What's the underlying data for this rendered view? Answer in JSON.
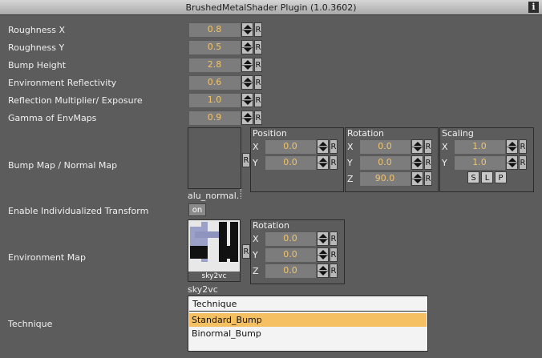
{
  "window": {
    "title": "BrushedMetalShader Plugin (1.0.3602)",
    "info_label": "i"
  },
  "params": [
    {
      "label": "Roughness X",
      "value": "0.8"
    },
    {
      "label": "Roughness Y",
      "value": "0.5"
    },
    {
      "label": "Bump Height",
      "value": "2.8"
    },
    {
      "label": "Environment Reflectivity",
      "value": "0.6"
    },
    {
      "label": "Reflection Multiplier/ Exposure",
      "value": "1.0"
    },
    {
      "label": "Gamma of EnvMaps",
      "value": "0.9"
    }
  ],
  "reset_label": "R",
  "bump": {
    "label": "Bump Map / Normal Map",
    "filename": "alu_normal.",
    "position": {
      "title": "Position",
      "x_label": "X",
      "x": "0.0",
      "y_label": "Y",
      "y": "0.0"
    },
    "rotation": {
      "title": "Rotation",
      "x_label": "X",
      "x": "0.0",
      "y_label": "Y",
      "y": "0.0",
      "z_label": "Z",
      "z": "90.0"
    },
    "scaling": {
      "title": "Scaling",
      "x_label": "X",
      "x": "1.0",
      "y_label": "Y",
      "y": "1.0",
      "buttons": [
        "S",
        "L",
        "P"
      ]
    }
  },
  "transform": {
    "label": "Enable Individualized Transform",
    "toggle": "on"
  },
  "env": {
    "label": "Environment Map",
    "caption": "sky2vc",
    "filename": "sky2vc",
    "rotation": {
      "title": "Rotation",
      "x_label": "X",
      "x": "0.0",
      "y_label": "Y",
      "y": "0.0",
      "z_label": "Z",
      "z": "0.0"
    }
  },
  "technique": {
    "label": "Technique",
    "header": "Technique",
    "items": [
      "Standard_Bump",
      "Binormal_Bump"
    ],
    "selected": "Standard_Bump"
  }
}
